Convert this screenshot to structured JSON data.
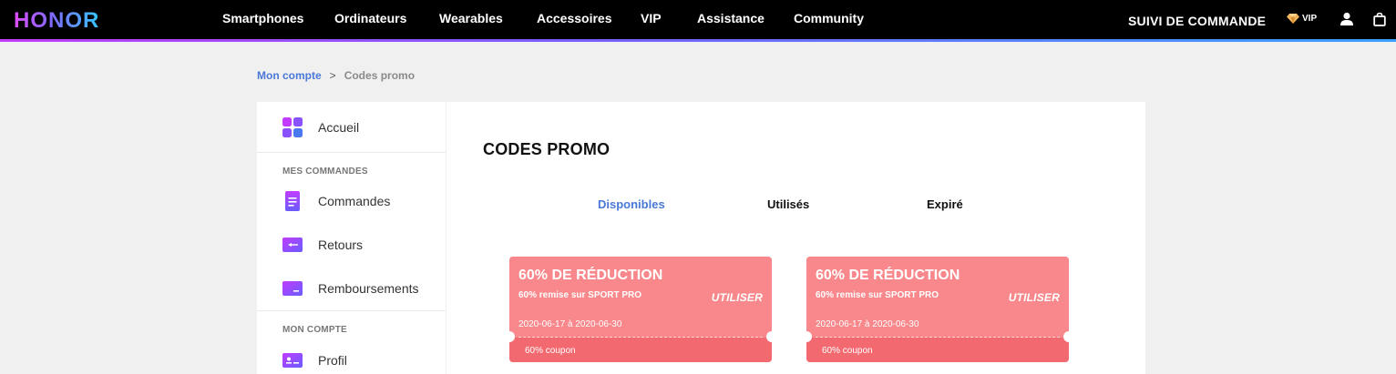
{
  "header": {
    "logo": "HONOR",
    "nav": [
      "Smartphones",
      "Ordinateurs",
      "Wearables",
      "Accessoires",
      "VIP",
      "Assistance",
      "Community"
    ],
    "order_tracking": "SUIVI DE COMMANDE",
    "vip_badge": "VIP",
    "icons": [
      "diamond-icon",
      "user-icon",
      "shopping-bag-icon"
    ],
    "accent_gradient": [
      "#e04cff",
      "#7f6bff",
      "#35c6ff"
    ]
  },
  "breadcrumb": {
    "root": "Mon compte",
    "separator": ">",
    "current": "Codes promo"
  },
  "sidebar": {
    "home": "Accueil",
    "orders_heading": "MES COMMANDES",
    "orders": [
      "Commandes",
      "Retours",
      "Remboursements"
    ],
    "account_heading": "MON COMPTE",
    "account": [
      "Profil"
    ]
  },
  "main": {
    "title": "CODES PROMO",
    "tabs": [
      "Disponibles",
      "Utilisés",
      "Expiré"
    ],
    "active_tab": "Disponibles",
    "coupons": [
      {
        "title": "60% DE RÉDUCTION",
        "description": "60% remise sur SPORT PRO",
        "action": "UTILISER",
        "validity": "2020-06-17 à 2020-06-30",
        "type": "60% coupon"
      },
      {
        "title": "60% DE RÉDUCTION",
        "description": "60% remise sur SPORT PRO",
        "action": "UTILISER",
        "validity": "2020-06-17 à 2020-06-30",
        "type": "60% coupon"
      }
    ]
  },
  "colors": {
    "link": "#4a78d8",
    "coupon": "#f8888b",
    "coupon_dark": "#f26a70"
  }
}
